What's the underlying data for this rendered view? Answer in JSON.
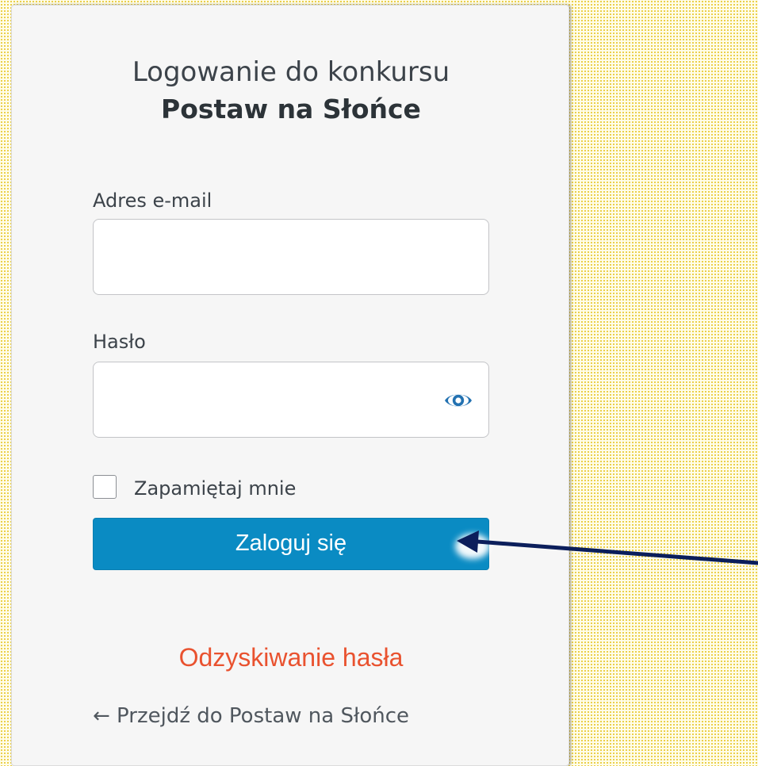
{
  "login": {
    "title_line1": "Logowanie do konkursu",
    "title_line2": "Postaw na Słońce",
    "email_label": "Adres e-mail",
    "email_value": "",
    "password_label": "Hasło",
    "password_value": "",
    "password_toggle_icon": "eye-icon",
    "remember_label": "Zapamiętaj mnie",
    "remember_checked": false,
    "submit_label": "Zaloguj się",
    "recover_link": "Odzyskiwanie hasła",
    "back_link": "← Przejdź do Postaw na Słońce"
  },
  "colors": {
    "button": "#0a8bc3",
    "recover_link": "#e9522f",
    "arrow": "#0b1e5b",
    "eye_icon": "#2271b1"
  }
}
